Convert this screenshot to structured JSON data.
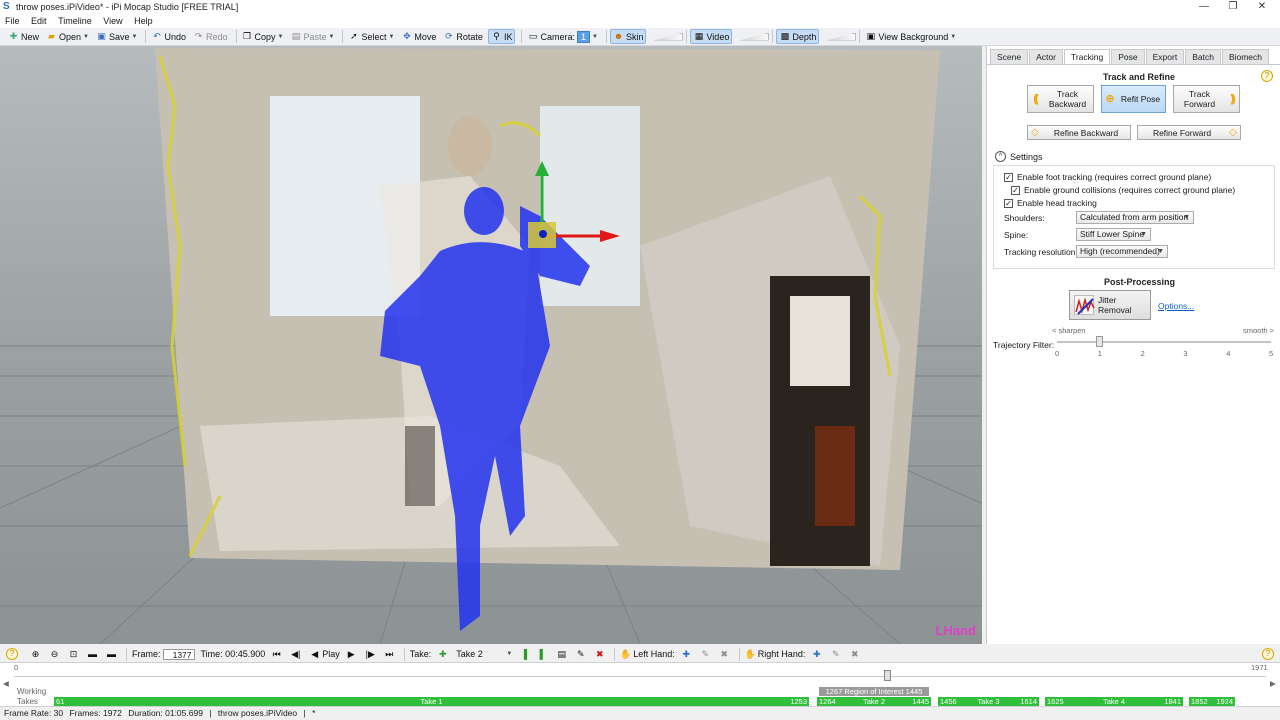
{
  "window": {
    "title": "throw poses.iPiVideo* - iPi Mocap Studio [FREE TRIAL]",
    "logo": "S",
    "controls": {
      "minimize": "—",
      "restore": "❐",
      "close": "✕"
    }
  },
  "menu": [
    "File",
    "Edit",
    "Timeline",
    "View",
    "Help"
  ],
  "toolbar": {
    "new": "New",
    "open": "Open",
    "save": "Save",
    "undo": "Undo",
    "redo": "Redo",
    "copy": "Copy",
    "paste": "Paste",
    "select": "Select",
    "move": "Move",
    "rotate": "Rotate",
    "ik": "IK",
    "camera": "Camera:",
    "camera_value": "1",
    "skin": "Skin",
    "video": "Video",
    "depth": "Depth",
    "view_background": "View Background"
  },
  "viewport": {
    "label": "LHand"
  },
  "panel": {
    "tabs": [
      "Scene",
      "Actor",
      "Tracking",
      "Pose",
      "Export",
      "Batch",
      "Biomech"
    ],
    "active_tab": "Tracking",
    "track_refine": {
      "title": "Track and Refine",
      "track_backward": "Track Backward",
      "refit_pose": "Refit Pose",
      "track_forward": "Track Forward",
      "refine_backward": "Refine Backward",
      "refine_forward": "Refine Forward"
    },
    "settings": {
      "title": "Settings",
      "foot_tracking": "Enable foot tracking (requires correct ground plane)",
      "ground_collisions": "Enable ground collisions (requires correct ground plane)",
      "head_tracking": "Enable head tracking",
      "shoulders_label": "Shoulders:",
      "shoulders_value": "Calculated from arm position",
      "spine_label": "Spine:",
      "spine_value": "Stiff Lower Spine",
      "resolution_label": "Tracking resolution:",
      "resolution_value": "High (recommended)"
    },
    "post_processing": {
      "title": "Post-Processing",
      "jitter_removal": "Jitter Removal",
      "options": "Options...",
      "sharpen": "< sharpen",
      "smooth": "smooth >",
      "trajectory_filter": "Trajectory Filter:",
      "ticks": [
        "0",
        "1",
        "2",
        "3",
        "4",
        "5"
      ],
      "trajectory_value": 1
    }
  },
  "playback": {
    "frame_label": "Frame:",
    "frame_value": "1377",
    "time_label": "Time: 00:45.900",
    "play": "Play",
    "take_label": "Take:",
    "take_value": "Take 2",
    "left_hand": "Left Hand:",
    "right_hand": "Right Hand:"
  },
  "timeline": {
    "start": "0",
    "end": "1971",
    "working_label": "Working",
    "takes_label": "Takes",
    "region_of_interest": "1267 Region of Interest 1445",
    "takes": [
      {
        "start": "61",
        "name": "Take 1",
        "end": "1253"
      },
      {
        "start": "1264",
        "name": "Take 2",
        "end": "1445"
      },
      {
        "start": "1456",
        "name": "Take 3",
        "end": "1614"
      },
      {
        "start": "1625",
        "name": "Take 4",
        "end": "1841"
      },
      {
        "start": "1852",
        "name": "",
        "end": "1924"
      }
    ]
  },
  "status": {
    "frame_rate": "Frame Rate: 30",
    "frames": "Frames: 1972",
    "duration": "Duration: 01:05.699",
    "file": "throw poses.iPiVideo",
    "modified": "*"
  },
  "colors": {
    "accent": "#f0a500",
    "take_green": "#2fbf3a",
    "actor_blue": "#2233ee",
    "label_magenta": "#e040c8"
  }
}
